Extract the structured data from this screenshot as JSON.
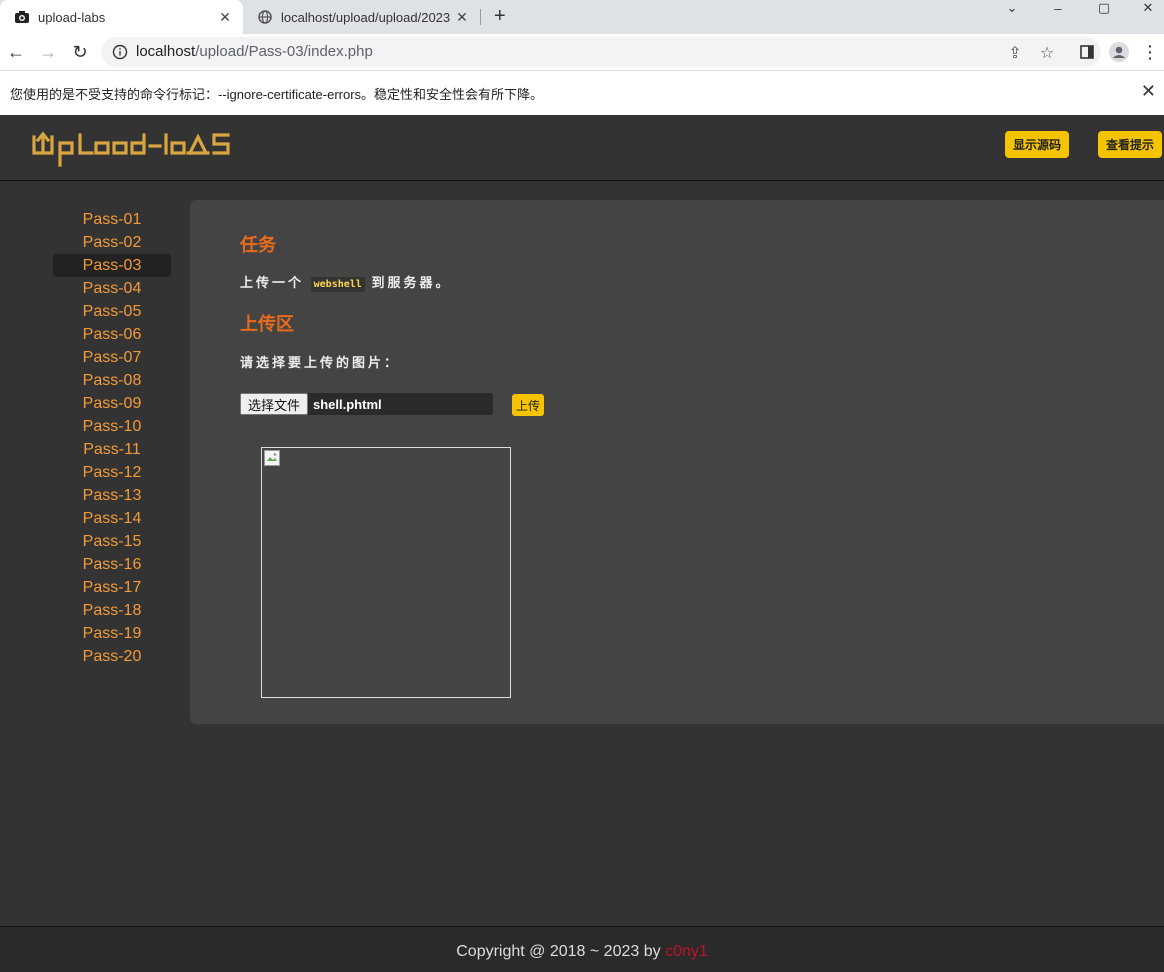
{
  "browser": {
    "tabs": [
      {
        "title": "upload-labs"
      },
      {
        "title": "localhost/upload/upload/2023"
      }
    ],
    "url_host": "localhost",
    "url_path": "/upload/Pass-03/index.php",
    "infobar_message": "您使用的是不受支持的命令行标记：--ignore-certificate-errors。稳定性和安全性会有所下降。"
  },
  "header": {
    "logo_text": "UpLoad-labs",
    "show_source_label": "显示源码",
    "show_hint_label": "查看提示"
  },
  "sidebar": {
    "active": "Pass-03",
    "items": [
      "Pass-01",
      "Pass-02",
      "Pass-03",
      "Pass-04",
      "Pass-05",
      "Pass-06",
      "Pass-07",
      "Pass-08",
      "Pass-09",
      "Pass-10",
      "Pass-11",
      "Pass-12",
      "Pass-13",
      "Pass-14",
      "Pass-15",
      "Pass-16",
      "Pass-17",
      "Pass-18",
      "Pass-19",
      "Pass-20"
    ]
  },
  "task": {
    "title": "任务",
    "text_before": "上传一个",
    "code": "webshell",
    "text_after": "到服务器。"
  },
  "upload": {
    "title": "上传区",
    "prompt": "请选择要上传的图片：",
    "choose_label": "选择文件",
    "file_name": "shell.phtml",
    "submit_label": "上传"
  },
  "footer": {
    "copyright": "Copyright @ 2018 ~ 2023 by ",
    "author": "c0ny1"
  },
  "colors": {
    "accent": "#f5c300",
    "link": "#f39b38",
    "heading": "#e86b1c",
    "author": "#c0102a"
  }
}
